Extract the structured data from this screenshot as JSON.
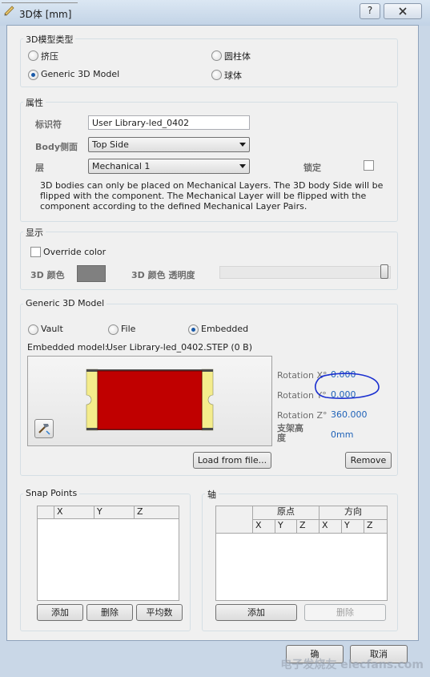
{
  "window": {
    "title": "3D体 [mm]",
    "help_button": "?",
    "close_button": "X"
  },
  "model_type": {
    "group_title": "3D模型类型",
    "options": [
      {
        "label": "挤压",
        "selected": false
      },
      {
        "label": "圆柱体",
        "selected": false
      },
      {
        "label": "Generic 3D Model",
        "selected": true
      },
      {
        "label": "球体",
        "selected": false
      }
    ]
  },
  "properties": {
    "group_title": "属性",
    "identifier_label": "标识符",
    "identifier_value": "User Library-led_0402",
    "body_side_label": "Body侧面",
    "body_side_value": "Top Side",
    "layer_label": "层",
    "layer_value": "Mechanical 1",
    "lock_label": "锁定",
    "lock_checked": false,
    "description_lines": [
      "3D bodies can only be placed on Mechanical Layers. The 3D body Side will be",
      "flipped with the component. The Mechanical Layer will be flipped with the",
      "component according to the defined Mechanical Layer Pairs."
    ]
  },
  "display": {
    "group_title": "显示",
    "override_color_label": "Override color",
    "override_checked": false,
    "color_label": "3D 颜色",
    "color_value": "#808080",
    "transparency_label": "3D 颜色 透明度",
    "transparency_level": 1.0
  },
  "generic_model": {
    "group_title": "Generic 3D Model",
    "source_options": [
      {
        "label": "Vault",
        "selected": false
      },
      {
        "label": "File",
        "selected": false
      },
      {
        "label": "Embedded",
        "selected": true
      }
    ],
    "embedded_label": "Embedded model:",
    "embedded_value": "User Library-led_0402.STEP (0 B)",
    "rotation_x_label": "Rotation X°",
    "rotation_x_value": "0.000",
    "rotation_y_label": "Rotation Y°",
    "rotation_y_value": "0.000",
    "rotation_z_label": "Rotation Z°",
    "rotation_z_value": "360.000",
    "standoff_label": "支架高度",
    "standoff_value": "0mm",
    "load_button": "Load from file...",
    "remove_button": "Remove"
  },
  "snap_points": {
    "group_title": "Snap Points",
    "columns": [
      "X",
      "Y",
      "Z"
    ],
    "add_button": "添加",
    "delete_button": "删除",
    "average_button": "平均数"
  },
  "axis": {
    "group_title": "轴",
    "header_origin": "原点",
    "header_direction": "方向",
    "columns": [
      "X",
      "Y",
      "Z",
      "X",
      "Y",
      "Z"
    ],
    "add_button": "添加",
    "delete_button": "删除"
  },
  "footer": {
    "ok_button": "确",
    "cancel_button": "取消",
    "watermark": "电子发烧友 elecfans.com"
  },
  "colors": {
    "component_body": "#c00000",
    "component_pads": "#f4ec8c",
    "annotation_circle": "#1a2fd0"
  }
}
